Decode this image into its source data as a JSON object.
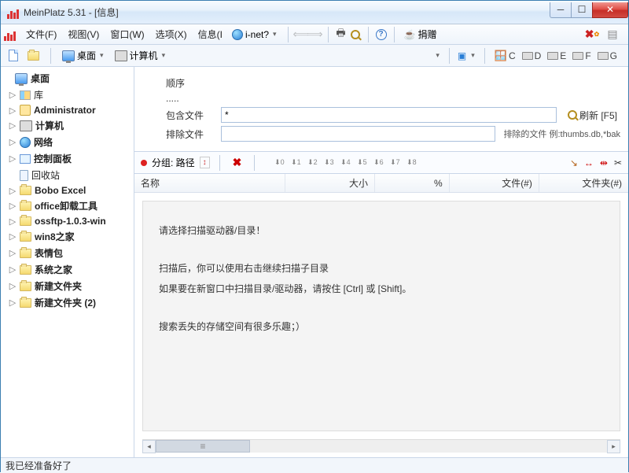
{
  "window": {
    "title": "MeinPlatz 5.31 - [信息]"
  },
  "menubar": {
    "file": "文件(F)",
    "view": "视图(V)",
    "window": "窗口(W)",
    "options": "选项(X)",
    "info": "信息(I",
    "inet": "i-net?",
    "donate": "捐赠"
  },
  "toolbar": {
    "desktop": "桌面",
    "computer": "计算机"
  },
  "drives": {
    "c": "C",
    "d": "D",
    "e": "E",
    "f": "F",
    "g": "G"
  },
  "tree": {
    "root": "桌面",
    "items": [
      {
        "label": "库",
        "icon": "lib",
        "bold": false
      },
      {
        "label": "Administrator",
        "icon": "user",
        "bold": true
      },
      {
        "label": "计算机",
        "icon": "computer",
        "bold": true
      },
      {
        "label": "网络",
        "icon": "net",
        "bold": true
      },
      {
        "label": "控制面板",
        "icon": "cpl",
        "bold": true
      },
      {
        "label": "回收站",
        "icon": "bin",
        "bold": false
      },
      {
        "label": "Bobo Excel",
        "icon": "folder",
        "bold": true
      },
      {
        "label": "office卸载工具",
        "icon": "folder",
        "bold": true
      },
      {
        "label": "ossftp-1.0.3-win",
        "icon": "folder",
        "bold": true
      },
      {
        "label": "win8之家",
        "icon": "folder",
        "bold": true
      },
      {
        "label": "表情包",
        "icon": "folder",
        "bold": true
      },
      {
        "label": "系统之家",
        "icon": "folder",
        "bold": true
      },
      {
        "label": "新建文件夹",
        "icon": "folder",
        "bold": true
      },
      {
        "label": "新建文件夹 (2)",
        "icon": "folder",
        "bold": true
      }
    ]
  },
  "filters": {
    "sequence_label": "顺序",
    "dots": ".....",
    "include_label": "包含文件",
    "include_value": "*",
    "exclude_label": "排除文件",
    "exclude_value": "",
    "refresh": "刷新  [F5]",
    "exclude_hint": "排除的文件 例:thumbs.db,*bak"
  },
  "groupbar": {
    "label": "分组: 路径"
  },
  "columns": {
    "name": "名称",
    "size": "大小",
    "pct": "%",
    "files": "文件(#)",
    "folders": "文件夹(#)"
  },
  "info": {
    "l1": "请选择扫描驱动器/目录！",
    "l2": "扫描后，你可以使用右击继续扫描子目录",
    "l3": "如果要在新窗口中扫描目录/驱动器，请按住 [Ctrl] 或 [Shift]。",
    "l4": "搜索丢失的存储空间有很多乐趣；）"
  },
  "status": "我已经准备好了"
}
